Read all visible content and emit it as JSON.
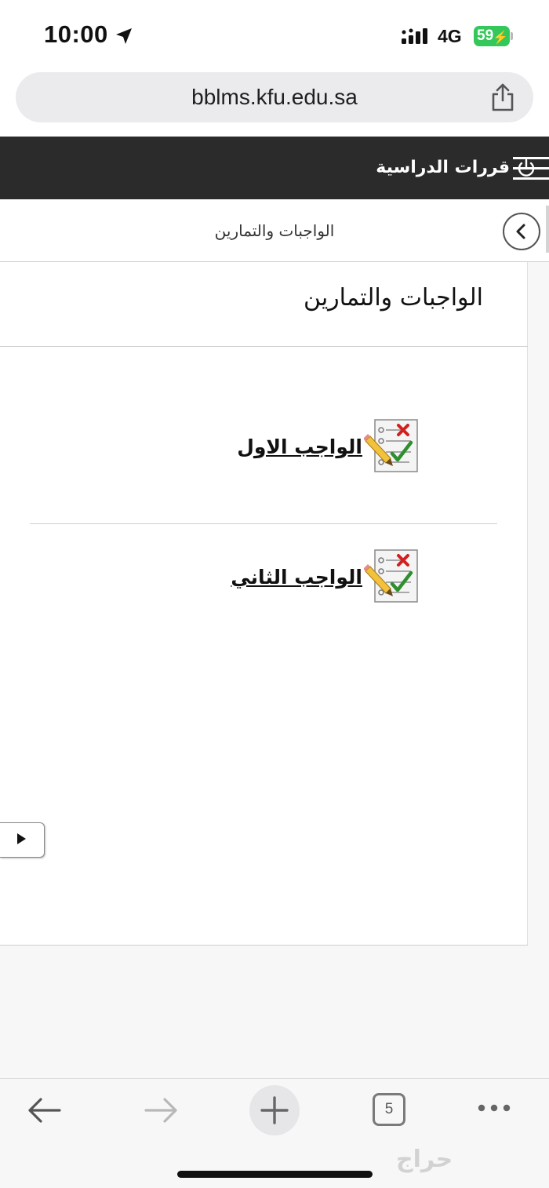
{
  "status_bar": {
    "time": "10:00",
    "network": "4G",
    "battery": "59"
  },
  "browser": {
    "url": "bblms.kfu.edu.sa",
    "tab_count": "5"
  },
  "course_header": {
    "title": "قررات الدراسية"
  },
  "breadcrumb": {
    "current": "الواجبات والتمارين"
  },
  "content": {
    "heading": "الواجبات والتمارين",
    "assignments": [
      {
        "title": "الواجب الاول",
        "icon": "assignment-checklist-icon"
      },
      {
        "title": "الواجب الثاني",
        "icon": "assignment-checklist-icon"
      }
    ]
  },
  "watermark": "حراج",
  "colors": {
    "header_bg": "#2b2b2b",
    "battery_green": "#34c759",
    "address_bar_bg": "#ebebed"
  }
}
